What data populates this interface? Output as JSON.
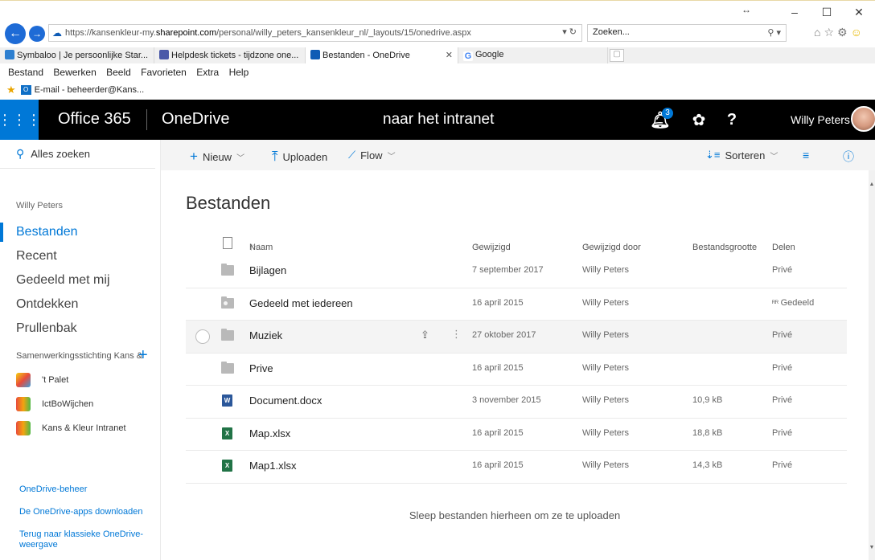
{
  "browser": {
    "url_prefix": "https://kansenkleur-my.",
    "url_host": "sharepoint.com",
    "url_path": "/personal/willy_peters_kansenkleur_nl/_layouts/15/onedrive.aspx",
    "search_placeholder": "Zoeken...",
    "tabs": [
      {
        "label": "Symbaloo | Je persoonlijke Star...",
        "icon_color": "#2d7fd0"
      },
      {
        "label": "Helpdesk tickets - tijdzone one...",
        "icon_color": "#4a59a8"
      },
      {
        "label": "Bestanden - OneDrive",
        "icon_color": "#0e5bb5"
      },
      {
        "label": "Google",
        "icon_color": "#4285f4"
      }
    ],
    "menu": [
      "Bestand",
      "Bewerken",
      "Beeld",
      "Favorieten",
      "Extra",
      "Help"
    ],
    "favorites_item": "E-mail - beheerder@Kans..."
  },
  "header": {
    "suite": "Office 365",
    "app": "OneDrive",
    "center_link": "naar het intranet",
    "notification_count": "3",
    "help_label": "?",
    "user": "Willy Peters",
    "accent": "#0078d7"
  },
  "left_nav": {
    "search": "Alles zoeken",
    "user": "Willy Peters",
    "items": [
      "Bestanden",
      "Recent",
      "Gedeeld met mij",
      "Ontdekken",
      "Prullenbak"
    ],
    "group_heading": "Samenwerkingsstichting Kans & Kleur",
    "sites": [
      "'t Palet",
      "IctBoWijchen",
      "Kans & Kleur Intranet"
    ],
    "footer": [
      "OneDrive-beheer",
      "De OneDrive-apps downloaden",
      "Terug naar klassieke OneDrive-weergave"
    ]
  },
  "command_bar": {
    "new": "Nieuw",
    "upload": "Uploaden",
    "flow": "Flow",
    "sort": "Sorteren"
  },
  "main": {
    "title": "Bestanden",
    "columns": {
      "name": "Naam",
      "modified": "Gewijzigd",
      "modified_by": "Gewijzigd door",
      "size": "Bestandsgrootte",
      "sharing": "Delen"
    },
    "rows": [
      {
        "name": "Bijlagen",
        "type": "folder",
        "date": "7 september 2017",
        "by": "Willy Peters",
        "size": "",
        "share": "Privé"
      },
      {
        "name": "Gedeeld met iedereen",
        "type": "shared-folder",
        "date": "16 april 2015",
        "by": "Willy Peters",
        "size": "",
        "share": "Gedeeld"
      },
      {
        "name": "Muziek",
        "type": "folder",
        "date": "27 oktober 2017",
        "by": "Willy Peters",
        "size": "",
        "share": "Privé"
      },
      {
        "name": "Prive",
        "type": "folder",
        "date": "16 april 2015",
        "by": "Willy Peters",
        "size": "",
        "share": "Privé"
      },
      {
        "name": "Document.docx",
        "type": "word",
        "date": "3 november 2015",
        "by": "Willy Peters",
        "size": "10,9 kB",
        "share": "Privé"
      },
      {
        "name": "Map.xlsx",
        "type": "excel",
        "date": "16 april 2015",
        "by": "Willy Peters",
        "size": "18,8 kB",
        "share": "Privé"
      },
      {
        "name": "Map1.xlsx",
        "type": "excel",
        "date": "16 april 2015",
        "by": "Willy Peters",
        "size": "14,3 kB",
        "share": "Privé"
      }
    ],
    "drop_hint": "Sleep bestanden hierheen om ze te uploaden"
  }
}
